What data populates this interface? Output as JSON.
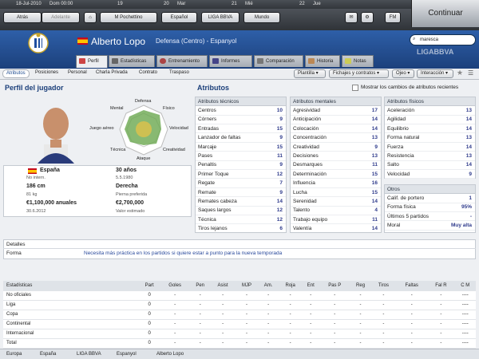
{
  "datebar": {
    "date": "18-Jul-2010",
    "day": "Dom 00:00",
    "d19": "19",
    "d20": "20",
    "mar": "Mar",
    "d21": "21",
    "mie": "Mié",
    "d22": "22",
    "jue": "Jue"
  },
  "nav": {
    "back": "Atrás",
    "forward": "Adelante",
    "manager": "M Pochettino",
    "language": "Español",
    "league": "LIGA BBVA",
    "world": "Mundo",
    "continue": "Continuar"
  },
  "player": {
    "name": "Alberto Lopo",
    "subtitle": "Defensa (Centro) - Espanyol"
  },
  "search": {
    "value": "maresca"
  },
  "tabs": [
    "Perfil",
    "Estadísticas",
    "Entrenamiento",
    "Informes",
    "Comparación",
    "Historia",
    "Notas"
  ],
  "subtabs": [
    "Atributos",
    "Posiciones",
    "Personal",
    "Charla Privada",
    "Contrato",
    "Traspaso"
  ],
  "actions": [
    "Plantilla",
    "Fichajes y contratos",
    "Ojeo",
    "Interacción"
  ],
  "profile": {
    "title": "Perfil del jugador",
    "radar": [
      "Defensa",
      "Físico",
      "Velocidad",
      "Creatividad",
      "Ataque",
      "Técnica",
      "Juego aéreo",
      "Mental"
    ],
    "nat": "España",
    "age": "30 años",
    "intl": "No intern.",
    "dob": "5.5.1980",
    "height": "186 cm",
    "foot": "Derecha",
    "weight": "81 kg",
    "foot_lbl": "Pierna preferida",
    "wage": "€1,100,000 anuales",
    "value": "€2,700,000",
    "expiry": "30.6.2012",
    "value_lbl": "Valor estimado"
  },
  "attributes": {
    "title": "Atributos",
    "show_changes": "Mostrar los cambios de atributos recientes",
    "tech_head": "Atributos técnicos",
    "mental_head": "Atributos mentales",
    "phys_head": "Atributos físicos",
    "other_head": "Otros",
    "technical": [
      [
        "Centros",
        "10"
      ],
      [
        "Córners",
        "9"
      ],
      [
        "Entradas",
        "15"
      ],
      [
        "Lanzador de faltas",
        "9"
      ],
      [
        "Marcaje",
        "15"
      ],
      [
        "Pases",
        "11"
      ],
      [
        "Penaltis",
        "9"
      ],
      [
        "Primer Toque",
        "12"
      ],
      [
        "Regate",
        "7"
      ],
      [
        "Remate",
        "9"
      ],
      [
        "Remates cabeza",
        "14"
      ],
      [
        "Saques largos",
        "12"
      ],
      [
        "Técnica",
        "12"
      ],
      [
        "Tiros lejanos",
        "6"
      ]
    ],
    "mental": [
      [
        "Agresividad",
        "17"
      ],
      [
        "Anticipación",
        "14"
      ],
      [
        "Colocación",
        "14"
      ],
      [
        "Concentración",
        "13"
      ],
      [
        "Creatividad",
        "9"
      ],
      [
        "Decisiones",
        "13"
      ],
      [
        "Desmarques",
        "11"
      ],
      [
        "Determinación",
        "15"
      ],
      [
        "Influencia",
        "16"
      ],
      [
        "Lucha",
        "15"
      ],
      [
        "Serenidad",
        "14"
      ],
      [
        "Talento",
        "4"
      ],
      [
        "Trabajo equipo",
        "11"
      ],
      [
        "Valentía",
        "14"
      ]
    ],
    "physical": [
      [
        "Aceleración",
        "13"
      ],
      [
        "Agilidad",
        "14"
      ],
      [
        "Equilibrio",
        "14"
      ],
      [
        "Forma natural",
        "13"
      ],
      [
        "Fuerza",
        "14"
      ],
      [
        "Resistencia",
        "13"
      ],
      [
        "Salto",
        "14"
      ],
      [
        "Velocidad",
        "9"
      ]
    ],
    "other": [
      [
        "Calif. de portero",
        "1"
      ],
      [
        "Forma física",
        "95%"
      ],
      [
        "Últimos 5 partidos",
        "-"
      ],
      [
        "Moral",
        "Muy alta"
      ]
    ]
  },
  "details": {
    "title": "Detalles",
    "form_lbl": "Forma",
    "form_text": "Necesita más práctica en los partidos si quiere estar a punto para la nueva temporada"
  },
  "stats": {
    "headers": [
      "Estadísticas",
      "Part",
      "Goles",
      "Pen",
      "Asist",
      "MJP",
      "Am.",
      "Roja",
      "Ent",
      "Pas P",
      "Reg",
      "Tiros",
      "Faltas",
      "Fal R",
      "C M"
    ],
    "rows": [
      [
        "No oficiales",
        "0",
        "-",
        "-",
        "-",
        "-",
        "-",
        "-",
        "-",
        "-",
        "-",
        "-",
        "-",
        "-",
        "----"
      ],
      [
        "Liga",
        "0",
        "-",
        "-",
        "-",
        "-",
        "-",
        "-",
        "-",
        "-",
        "-",
        "-",
        "-",
        "-",
        "----"
      ],
      [
        "Copa",
        "0",
        "-",
        "-",
        "-",
        "-",
        "-",
        "-",
        "-",
        "-",
        "-",
        "-",
        "-",
        "-",
        "----"
      ],
      [
        "Continental",
        "0",
        "-",
        "-",
        "-",
        "-",
        "-",
        "-",
        "-",
        "-",
        "-",
        "-",
        "-",
        "-",
        "----"
      ],
      [
        "Internacional",
        "0",
        "-",
        "-",
        "-",
        "-",
        "-",
        "-",
        "-",
        "-",
        "-",
        "-",
        "-",
        "-",
        "----"
      ],
      [
        "Total",
        "0",
        "-",
        "-",
        "-",
        "-",
        "-",
        "-",
        "-",
        "-",
        "-",
        "-",
        "-",
        "-",
        "----"
      ]
    ]
  },
  "breadcrumb": [
    "Europa",
    "España",
    "LIGA BBVA",
    "Espanyol",
    "Alberto Lopo"
  ],
  "colors": {
    "header": "#2e5fa8",
    "value": "#2f3b8c",
    "accent": "#1b3f7a"
  }
}
